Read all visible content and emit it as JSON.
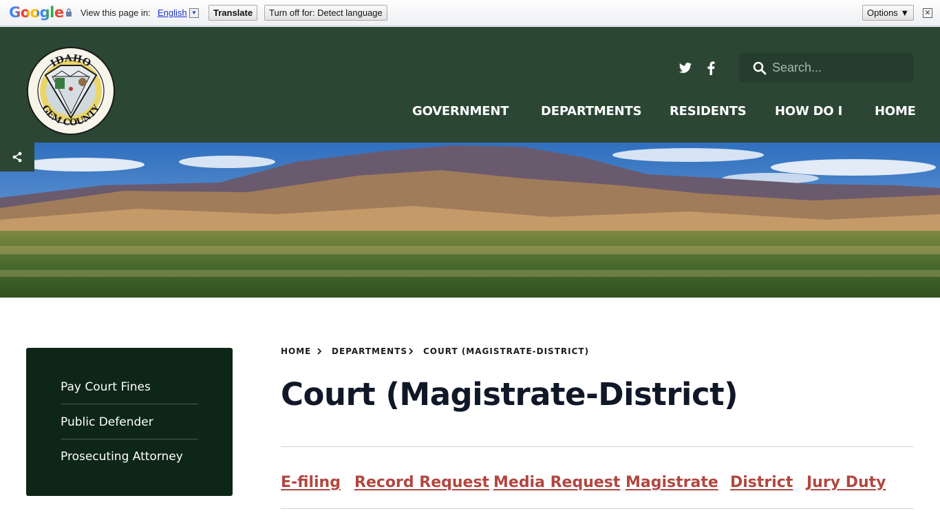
{
  "translate_bar": {
    "logo": "Google",
    "view_label": "View this page in:",
    "language": "English",
    "translate_button": "Translate",
    "turn_off_button": "Turn off for: Detect language",
    "options_button": "Options ▼",
    "close_symbol": "✕"
  },
  "header": {
    "seal_top_text": "IDAHO",
    "seal_bottom_text": "GEM COUNTY",
    "search_placeholder": "Search...",
    "nav": [
      "GOVERNMENT",
      "DEPARTMENTS",
      "RESIDENTS",
      "HOW DO I",
      "HOME"
    ],
    "icons": {
      "twitter": "twitter-icon",
      "facebook": "facebook-icon",
      "search": "search-icon",
      "share": "share-icon"
    }
  },
  "sidebar": {
    "items": [
      "Pay Court Fines",
      "Public Defender",
      "Prosecuting Attorney"
    ]
  },
  "breadcrumb": {
    "items": [
      "HOME",
      "DEPARTMENTS",
      "COURT (MAGISTRATE-DISTRICT)"
    ]
  },
  "page_title": "Court (Magistrate-District)",
  "tabs": [
    "E-filing",
    "Record Request",
    "Media Request",
    "Magistrate",
    "District",
    "Jury Duty"
  ],
  "colors": {
    "header_green": "#2c4634",
    "sidebar_green": "#0d2617",
    "link_red": "#b2473f",
    "title_dark": "#101828"
  }
}
